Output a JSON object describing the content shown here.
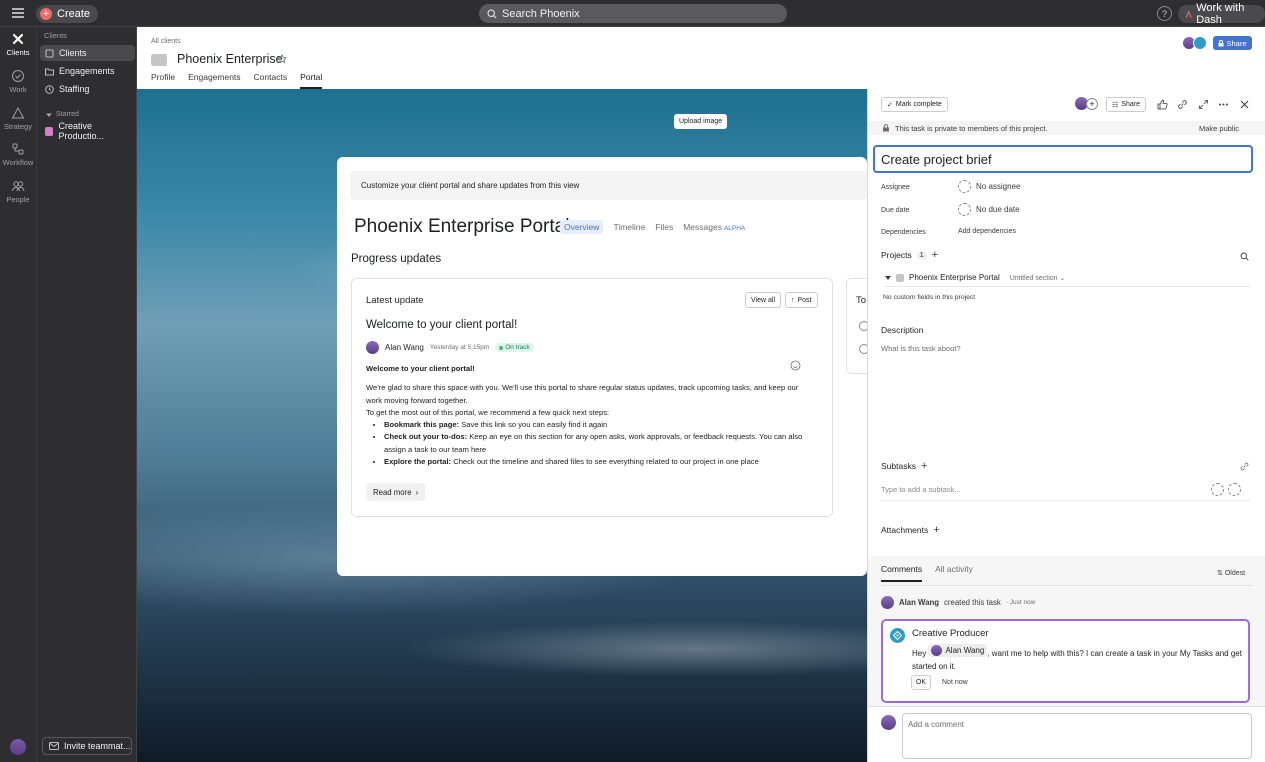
{
  "topbar": {
    "create_label": "Create",
    "search_placeholder": "Search Phoenix",
    "help_label": "?",
    "work_with_dash_label": "Work with Dash"
  },
  "rail": {
    "items": [
      {
        "label": "Clients",
        "icon": "clients-icon",
        "active": true
      },
      {
        "label": "Work",
        "icon": "check-circle-icon"
      },
      {
        "label": "Strategy",
        "icon": "triangle-icon"
      },
      {
        "label": "Workflow",
        "icon": "workflow-icon"
      },
      {
        "label": "People",
        "icon": "people-icon"
      }
    ]
  },
  "sidebar": {
    "header": "Clients",
    "items": [
      {
        "label": "Clients",
        "icon": "clients-icon",
        "active": true
      },
      {
        "label": "Engagements",
        "icon": "folder-icon"
      },
      {
        "label": "Staffing",
        "icon": "staffing-icon"
      }
    ],
    "starred_label": "Starred",
    "starred_items": [
      {
        "label": "Creative Productio..."
      }
    ],
    "invite_label": "Invite teammat..."
  },
  "header": {
    "breadcrumb": "All clients",
    "title": "Phoenix Enterprise",
    "tabs": [
      "Profile",
      "Engagements",
      "Contacts",
      "Portal"
    ],
    "active_tab": "Portal",
    "share_label": "Share"
  },
  "banner": {
    "upload_label": "Upload image"
  },
  "portal": {
    "notice": "Customize your client portal and share updates from this view",
    "title": "Phoenix Enterprise Portal",
    "tabs": [
      "Overview",
      "Timeline",
      "Files",
      "Messages"
    ],
    "alpha_label": "ALPHA",
    "progress_heading": "Progress updates",
    "latest_update": {
      "heading": "Latest update",
      "view_all": "View all",
      "post": "Post",
      "title": "Welcome to your client portal!",
      "author": "Alan Wang",
      "time": "Yesterday at 5:15pm",
      "status": "On track",
      "subtitle": "Welcome to your client portal!",
      "intro": "We're glad to share this space with you. We'll use this portal to share regular status updates, track upcoming tasks, and keep our work moving forward together.",
      "next_steps": "To get the most out of this portal, we recommend a few quick next steps:",
      "bullets": [
        {
          "bold": "Bookmark this page:",
          "text": " Save this link so you can easily find it again"
        },
        {
          "bold": "Check out your to-dos:",
          "text": " Keep an eye on this section for any open asks, work approvals, or feedback requests. You can also assign a task to our team here"
        },
        {
          "bold": "Explore the portal:",
          "text": " Check out the timeline and shared files to see everything related to our project in one place"
        }
      ],
      "read_more": "Read more"
    },
    "todo_heading": "To"
  },
  "task_panel": {
    "mark_complete": "Mark complete",
    "share_label": "Share",
    "private_notice": "This task is private to members of this project.",
    "make_public": "Make public",
    "title": "Create project brief",
    "fields": {
      "assignee_label": "Assignee",
      "assignee_value": "No assignee",
      "due_label": "Due date",
      "due_value": "No due date",
      "dependencies_label": "Dependencies",
      "dependencies_value": "Add dependencies"
    },
    "projects_label": "Projects",
    "projects_count": "1",
    "project_name": "Phoenix Enterprise Portal",
    "project_section": "Untitled section",
    "no_custom_fields": "No custom fields in this project",
    "description_label": "Description",
    "description_placeholder": "What is this task about?",
    "subtasks_label": "Subtasks",
    "subtask_placeholder": "Type to add a subtask...",
    "attachments_label": "Attachments"
  },
  "comments": {
    "tabs": [
      "Comments",
      "All activity"
    ],
    "sort_label": "Oldest",
    "activity_author": "Alan Wang",
    "activity_text": "created this task",
    "activity_time": "· Just now",
    "bot_name": "Creative Producer",
    "bot_greeting": "Hey",
    "bot_mention": "Alan Wang",
    "bot_message": ", want me to help with this? I can create a task in your My Tasks and get started on it.",
    "ok_label": "OK",
    "not_now_label": "Not now",
    "input_placeholder": "Add a comment"
  },
  "colors": {
    "accent": "#4573d2",
    "create": "#f06a6a",
    "bot_border": "#9d6cd8",
    "on_track": "#3dbd7e"
  }
}
